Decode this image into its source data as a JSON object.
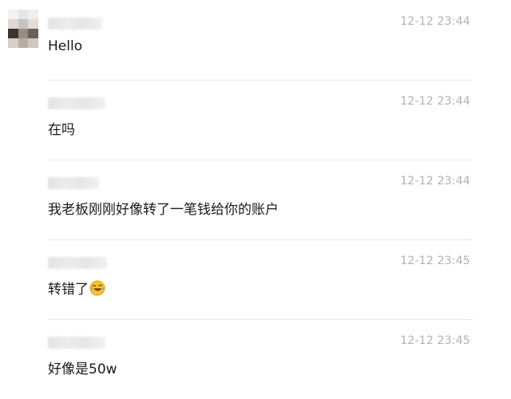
{
  "messages": [
    {
      "time": "12-12 23:44",
      "text": "Hello"
    },
    {
      "time": "12-12 23:44",
      "text": "在吗"
    },
    {
      "time": "12-12 23:44",
      "text": "我老板刚刚好像转了一笔钱给你的账户"
    },
    {
      "time": "12-12 23:45",
      "text": "转错了",
      "emoji": "laughing-crying-emoji-icon"
    },
    {
      "time": "12-12 23:45",
      "text": "好像是50w"
    }
  ],
  "colors": {
    "timestamp": "#b2b2b2",
    "message_text": "#1a1a1a",
    "divider": "#e7e7e7"
  }
}
